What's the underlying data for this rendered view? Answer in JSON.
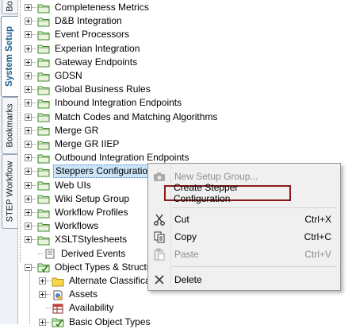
{
  "tabs": [
    {
      "label": "Bo",
      "active": false
    },
    {
      "label": "System Setup",
      "active": true
    },
    {
      "label": "Bookmarks",
      "active": false
    },
    {
      "label": "STEP Workflow",
      "active": false
    }
  ],
  "tree": {
    "items": [
      {
        "label": "Completeness Metrics",
        "icon": "folder-green-icon"
      },
      {
        "label": "D&B Integration",
        "icon": "folder-green-icon"
      },
      {
        "label": "Event Processors",
        "icon": "folder-green-icon"
      },
      {
        "label": "Experian Integration",
        "icon": "folder-green-icon"
      },
      {
        "label": "Gateway Endpoints",
        "icon": "folder-green-icon"
      },
      {
        "label": "GDSN",
        "icon": "folder-green-icon"
      },
      {
        "label": "Global Business Rules",
        "icon": "folder-green-icon"
      },
      {
        "label": "Inbound Integration Endpoints",
        "icon": "folder-green-icon"
      },
      {
        "label": "Match Codes and Matching Algorithms",
        "icon": "folder-green-icon"
      },
      {
        "label": "Merge GR",
        "icon": "folder-green-icon"
      },
      {
        "label": "Merge GR IIEP",
        "icon": "folder-green-icon"
      },
      {
        "label": "Outbound Integration Endpoints",
        "icon": "folder-green-icon"
      },
      {
        "label": "Steppers Configurations",
        "icon": "folder-green-icon",
        "selected": true
      },
      {
        "label": "Web UIs",
        "icon": "folder-green-icon"
      },
      {
        "label": "Wiki Setup Group",
        "icon": "folder-green-icon"
      },
      {
        "label": "Workflow Profiles",
        "icon": "folder-green-icon"
      },
      {
        "label": "Workflows",
        "icon": "folder-green-icon"
      },
      {
        "label": "XSLTStylesheets",
        "icon": "folder-green-icon"
      }
    ],
    "derived_events": "Derived Events",
    "object_types": "Object Types & Structur",
    "children": [
      {
        "label": "Alternate Classificati",
        "icon": "folder-yellow-icon"
      },
      {
        "label": "Assets",
        "icon": "asset-icon"
      },
      {
        "label": "Availability",
        "icon": "table-icon"
      },
      {
        "label": "Basic Object Types",
        "icon": "folder-check-icon"
      }
    ]
  },
  "context_menu": {
    "new_setup_group": "New Setup Group...",
    "create_stepper": "Create Stepper Configuration",
    "cut": "Cut",
    "cut_key": "Ctrl+X",
    "copy": "Copy",
    "copy_key": "Ctrl+C",
    "paste": "Paste",
    "paste_key": "Ctrl+V",
    "delete": "Delete"
  }
}
